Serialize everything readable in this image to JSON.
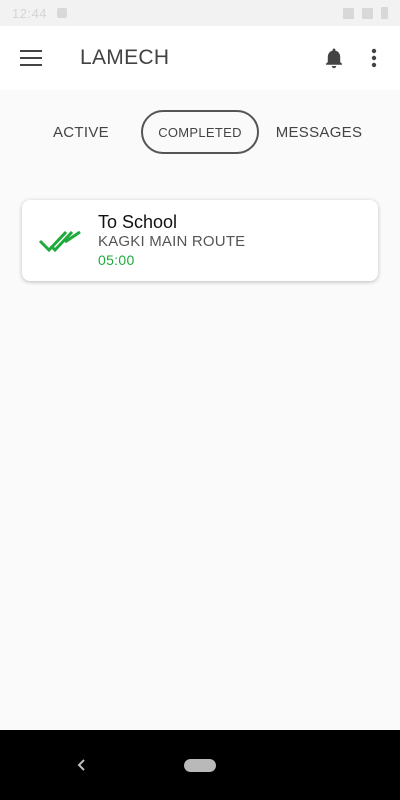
{
  "status_bar": {
    "time": "12:44"
  },
  "app_bar": {
    "title": "LAMECH",
    "menu_icon": "hamburger-menu-icon",
    "notifications_icon": "bell-icon",
    "more_icon": "more-vert-icon"
  },
  "tabs": [
    {
      "label": "ACTIVE",
      "selected": false
    },
    {
      "label": "COMPLETED",
      "selected": true
    },
    {
      "label": "MESSAGES",
      "selected": false
    }
  ],
  "trips": [
    {
      "name": "To School",
      "route": "KAGKI MAIN ROUTE",
      "time": "05:00",
      "status_icon": "double-check-icon"
    }
  ],
  "colors": {
    "accent_green": "#1faa3c",
    "text_primary": "#111111",
    "text_secondary": "#555555"
  }
}
